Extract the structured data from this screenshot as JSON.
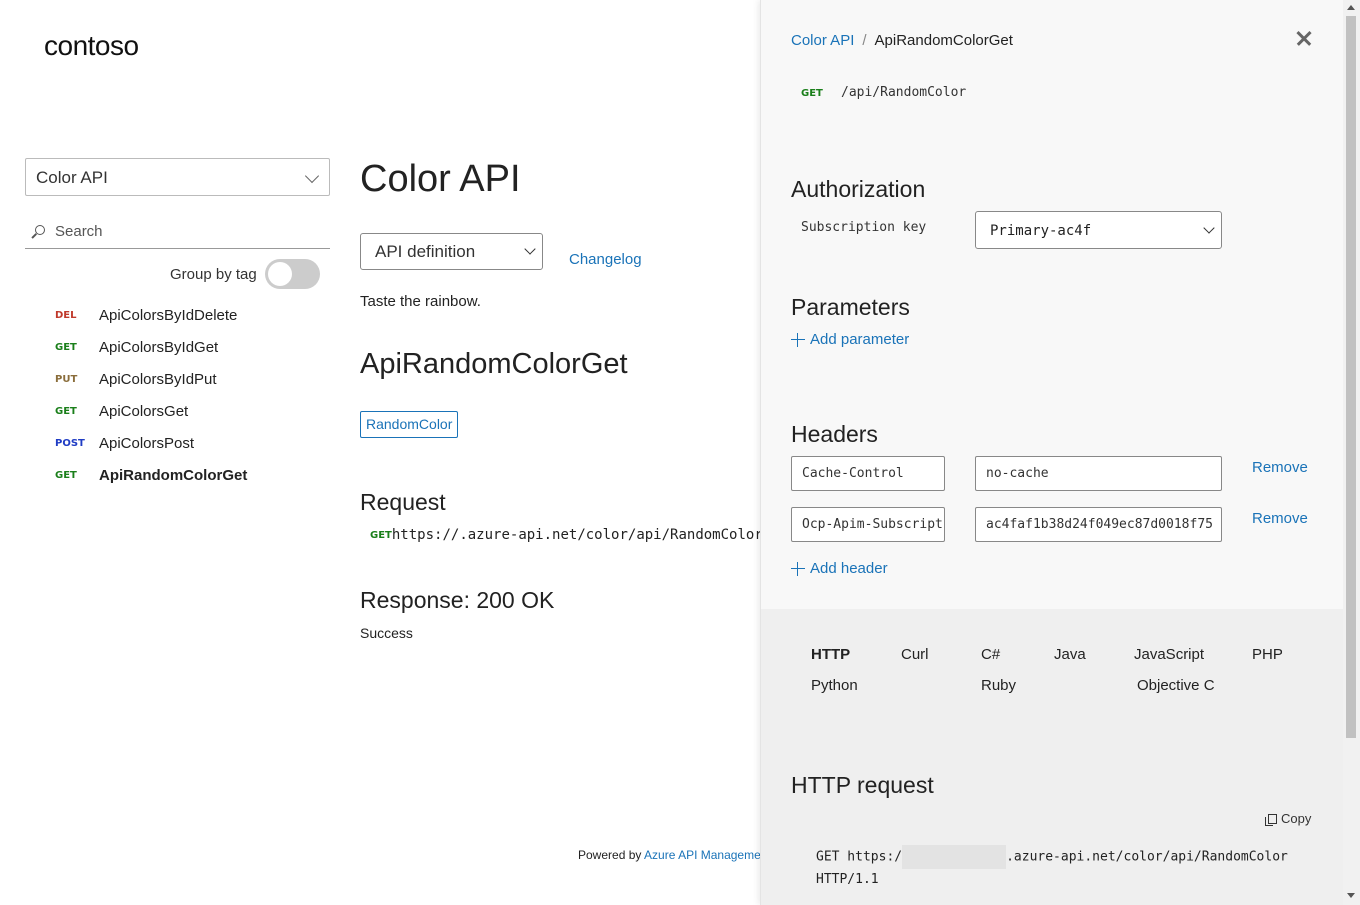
{
  "brand": {
    "logo": "contoso"
  },
  "sidebar": {
    "api_selected": "Color API",
    "search_placeholder": "Search",
    "group_by_tag_label": "Group by tag",
    "operations": [
      {
        "verb": "DEL",
        "name": "ApiColorsByIdDelete"
      },
      {
        "verb": "GET",
        "name": "ApiColorsByIdGet"
      },
      {
        "verb": "PUT",
        "name": "ApiColorsByIdPut"
      },
      {
        "verb": "GET",
        "name": "ApiColorsGet"
      },
      {
        "verb": "POST",
        "name": "ApiColorsPost"
      },
      {
        "verb": "GET",
        "name": "ApiRandomColorGet"
      }
    ]
  },
  "main": {
    "title": "Color API",
    "definition_select": "API definition",
    "changelog": "Changelog",
    "description": "Taste the rainbow.",
    "operation_title": "ApiRandomColorGet",
    "tag": "RandomColor",
    "request_title": "Request",
    "request_verb": "GET",
    "request_url_prefix": "https://",
    "request_url_suffix": ".azure-api.net/color/api/RandomColor",
    "response_title": "Response: 200 OK",
    "response_desc": "Success",
    "powered_prefix": "Powered by ",
    "powered_link": "Azure API Management"
  },
  "panel": {
    "breadcrumb_root": "Color API",
    "breadcrumb_sep": "/",
    "breadcrumb_current": "ApiRandomColorGet",
    "verb": "GET",
    "path": "/api/RandomColor",
    "authorization_title": "Authorization",
    "subscription_label": "Subscription key",
    "subscription_value": "Primary-ac4f",
    "parameters_title": "Parameters",
    "add_parameter": "Add parameter",
    "headers_title": "Headers",
    "headers": [
      {
        "name": "Cache-Control",
        "value": "no-cache",
        "remove": "Remove"
      },
      {
        "name": "Ocp-Apim-Subscription-Key",
        "value": "ac4faf1b38d24f049ec87d0018f75",
        "remove": "Remove"
      }
    ],
    "add_header": "Add header",
    "languages": [
      "HTTP",
      "Curl",
      "C#",
      "Java",
      "JavaScript",
      "PHP",
      "Python",
      "Ruby",
      "Objective C"
    ],
    "active_language": "HTTP",
    "http_request_title": "HTTP request",
    "copy": "Copy",
    "code_prefix": "GET https:/",
    "code_suffix": ".azure-api.net/color/api/RandomColor",
    "code_line2": "HTTP/1.1"
  },
  "colors": {
    "link": "#1a73b8",
    "get": "#1a7f1a",
    "del": "#c0392b",
    "put": "#8a6d3b",
    "post": "#1f3cc4"
  }
}
